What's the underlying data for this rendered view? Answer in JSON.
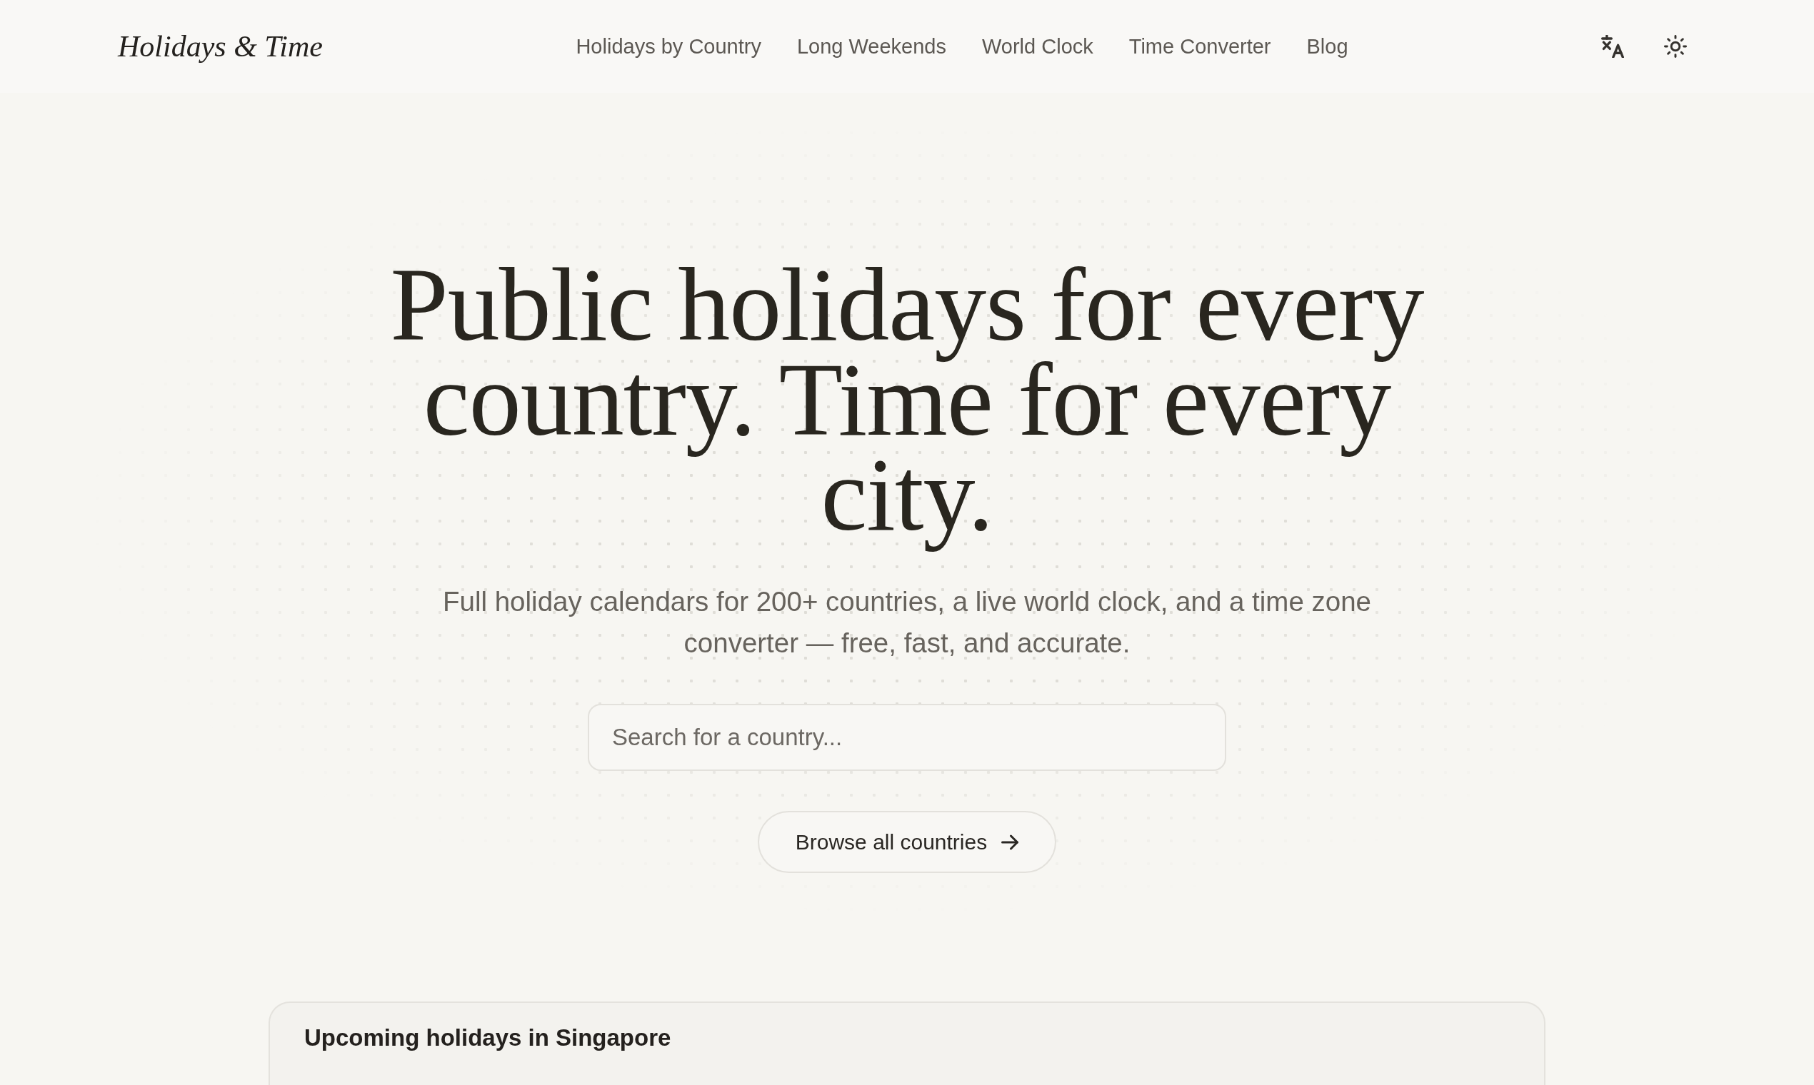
{
  "header": {
    "logo": "Holidays & Time",
    "nav": [
      "Holidays by Country",
      "Long Weekends",
      "World Clock",
      "Time Converter",
      "Blog"
    ]
  },
  "hero": {
    "title": "Public holidays for every country. Time for every city.",
    "subtitle": "Full holiday calendars for 200+ countries, a live world clock, and a time zone converter — free, fast, and accurate.",
    "search": {
      "placeholder": "Search for a country..."
    },
    "button": "Browse all countries"
  },
  "upcoming": {
    "heading": "Upcoming holidays in Singapore"
  }
}
